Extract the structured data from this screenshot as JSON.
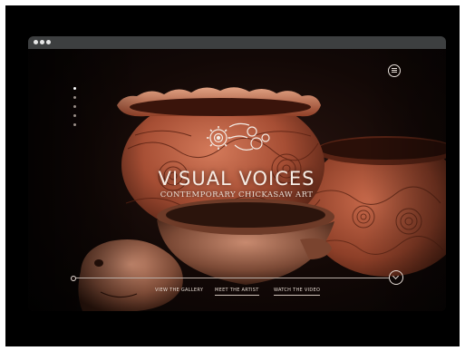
{
  "window": {
    "controls": [
      "dot",
      "dot",
      "dot"
    ]
  },
  "hero": {
    "title": "VISUAL VOICES",
    "subtitle": "CONTEMPORARY CHICKASAW ART"
  },
  "menu": {
    "icon": "hamburger-menu-icon"
  },
  "section_nav": {
    "count": 5,
    "active_index": 0
  },
  "logo": {
    "icon": "sun-spiral-emblem-icon"
  },
  "timeline": {
    "next_icon": "chevron-right-icon"
  },
  "nav_links": [
    {
      "label": "VIEW THE GALLERY"
    },
    {
      "label": "MEET THE ARTIST"
    },
    {
      "label": "WATCH THE VIDEO"
    }
  ],
  "colors": {
    "frame": "#000000",
    "titlebar": "#3d3f40",
    "clay": "#a9533a",
    "text": "#f6ece4"
  }
}
